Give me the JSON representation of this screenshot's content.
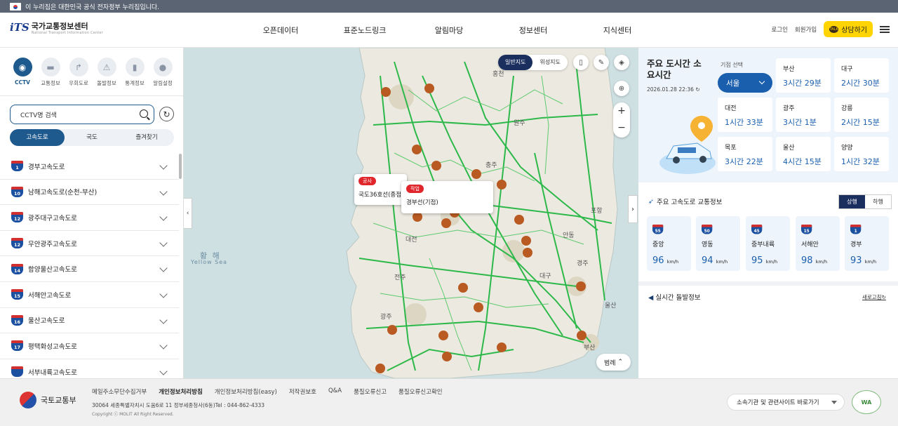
{
  "gov_banner": {
    "text": "이 누리집은 대한민국 공식 전자정부 누리집입니다."
  },
  "header": {
    "logo_mark": "iTS",
    "logo_name": "국가교통정보센터",
    "logo_sub": "National Transport Information Center",
    "nav": [
      "오픈데이터",
      "표준노드링크",
      "알림마당",
      "정보센터",
      "지식센터"
    ],
    "login": "로그인",
    "signup": "회원가입",
    "talk_icon": "TALK",
    "talk_label": "상담하기"
  },
  "sidebar": {
    "categories": [
      {
        "label": "CCTV",
        "icon": "cctv-icon"
      },
      {
        "label": "교통정보",
        "icon": "car-icon"
      },
      {
        "label": "우회도로",
        "icon": "detour-icon"
      },
      {
        "label": "돌발정보",
        "icon": "incident-icon"
      },
      {
        "label": "통계정보",
        "icon": "stats-icon"
      },
      {
        "label": "알림설정",
        "icon": "location-icon"
      }
    ],
    "search_placeholder": "CCTV명 검색",
    "tabs": [
      "고속도로",
      "국도",
      "즐겨찾기"
    ],
    "highways": [
      {
        "no": "1",
        "name": "경부고속도로"
      },
      {
        "no": "10",
        "name": "남해고속도로(순천-부산)"
      },
      {
        "no": "12",
        "name": "광주대구고속도로"
      },
      {
        "no": "12",
        "name": "무안광주고속도로"
      },
      {
        "no": "14",
        "name": "함양울산고속도로"
      },
      {
        "no": "15",
        "name": "서해안고속도로"
      },
      {
        "no": "16",
        "name": "울산고속도로"
      },
      {
        "no": "17",
        "name": "평택화성고속도로"
      },
      {
        "no": "",
        "name": "서부내륙고속도로"
      }
    ]
  },
  "map": {
    "toggle": [
      "일반지도",
      "위성지도"
    ],
    "sea_label_ko": "황 해",
    "sea_label_en": "Yellow Sea",
    "popup1": {
      "tag": "공사",
      "text": "국도36호선(종점"
    },
    "popup2": {
      "tag": "작업",
      "text": "경부선(기점)"
    },
    "legend": "범례",
    "zoom_in": "+",
    "zoom_out": "−",
    "cities": [
      "홍천",
      "원주",
      "충주",
      "청주",
      "대전",
      "전주",
      "광주",
      "대구",
      "울산",
      "부산",
      "포항",
      "안동",
      "경주"
    ]
  },
  "right_panel": {
    "title": "주요 도시간 소요시간",
    "date": "2026.01.28  22:36",
    "origin_label": "기점 선택",
    "origin": "서울",
    "cities": [
      {
        "name": "부산",
        "time": "3시간 29분"
      },
      {
        "name": "대구",
        "time": "2시간 30분"
      },
      {
        "name": "대전",
        "time": "1시간 33분"
      },
      {
        "name": "광주",
        "time": "3시간 1분"
      },
      {
        "name": "강릉",
        "time": "2시간 15분"
      },
      {
        "name": "목포",
        "time": "3시간 22분"
      },
      {
        "name": "울산",
        "time": "4시간 15분"
      },
      {
        "name": "양양",
        "time": "1시간 32분"
      }
    ],
    "hw_title": "주요 고속도로 교통정보",
    "dir_tabs": [
      "상행",
      "하행"
    ],
    "speeds": [
      {
        "no": "55",
        "name": "중앙",
        "speed": "96",
        "unit": "km/h"
      },
      {
        "no": "50",
        "name": "영동",
        "speed": "94",
        "unit": "km/h"
      },
      {
        "no": "45",
        "name": "중부내륙",
        "speed": "95",
        "unit": "km/h"
      },
      {
        "no": "15",
        "name": "서해안",
        "speed": "98",
        "unit": "km/h"
      },
      {
        "no": "1",
        "name": "경부",
        "speed": "93",
        "unit": "km/h"
      }
    ],
    "incident_title": "실시간 돌발정보",
    "refresh": "새로고침"
  },
  "footer": {
    "ministry": "국토교통부",
    "links": [
      "메일주소무단수집거부",
      "개인정보처리방침",
      "개인정보처리방침(easy)",
      "저작권보호",
      "Q&A",
      "품질오류신고",
      "품질오류신고확인"
    ],
    "address": "30064  세종특별자치시  도움6로  11  정부세종청사(6동)Tel : 044-862-4333",
    "copyright": "Copyright  ⓒ  MOLIT  All  Right  Reserved.",
    "related": "소속기관 및 관련사이트 바로가기",
    "wa_mark": "WA"
  }
}
